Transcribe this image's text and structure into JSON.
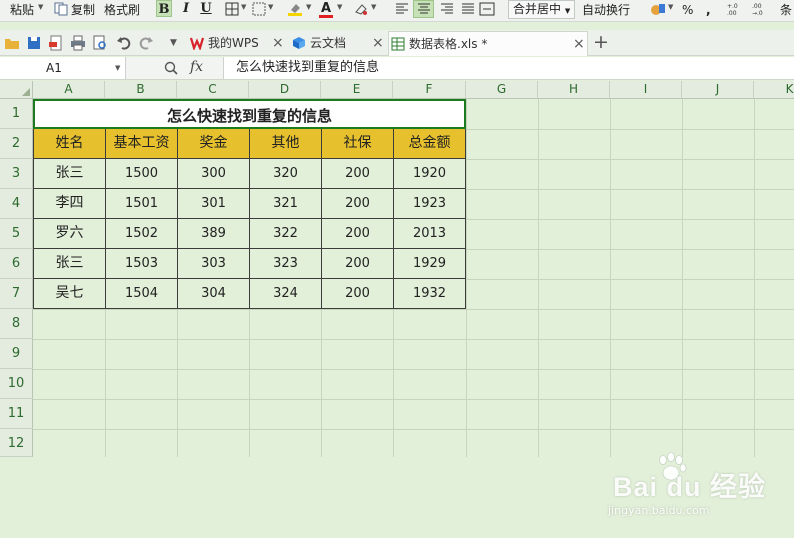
{
  "ribbon": {
    "paste_label": "粘贴",
    "copy_label": "复制",
    "format_painter_label": "格式刷",
    "bold": "B",
    "italic": "I",
    "underline": "U",
    "font_color_letter": "A",
    "merge_center_label": "合并居中",
    "wrap_text_label": "自动换行",
    "percent": "%",
    "comma": ",",
    "conditional_label": "条",
    "accent_color": "#c7e1b7"
  },
  "tabs": [
    {
      "label": "我的WPS",
      "close": "×"
    },
    {
      "label": "云文档",
      "close": "×"
    },
    {
      "label": "数据表格.xls *",
      "close": "×"
    }
  ],
  "new_tab": "+",
  "formula_bar": {
    "cell_ref": "A1",
    "fx_label": "fx",
    "content": "怎么快速找到重复的信息"
  },
  "grid": {
    "columns": [
      "A",
      "B",
      "C",
      "D",
      "E",
      "F",
      "G",
      "H",
      "I",
      "J",
      "K"
    ],
    "rows": [
      "1",
      "2",
      "3",
      "4",
      "5",
      "6",
      "7",
      "8",
      "9",
      "10",
      "11",
      "12"
    ]
  },
  "table": {
    "title": "怎么快速找到重复的信息",
    "headers": [
      "姓名",
      "基本工资",
      "奖金",
      "其他",
      "社保",
      "总金额"
    ],
    "rows": [
      [
        "张三",
        "1500",
        "300",
        "320",
        "200",
        "1920"
      ],
      [
        "李四",
        "1501",
        "301",
        "321",
        "200",
        "1923"
      ],
      [
        "罗六",
        "1502",
        "389",
        "322",
        "200",
        "2013"
      ],
      [
        "张三",
        "1503",
        "303",
        "323",
        "200",
        "1929"
      ],
      [
        "吴七",
        "1504",
        "304",
        "324",
        "200",
        "1932"
      ]
    ],
    "header_color": "#e7c12d",
    "sheet_color": "#e2efd9"
  },
  "watermark": {
    "text": "Bai du 经验",
    "url": "jingyan.baidu.com"
  }
}
